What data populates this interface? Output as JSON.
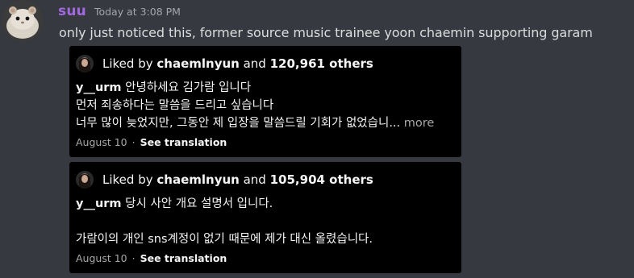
{
  "message": {
    "username": "suu",
    "timestamp": "Today at 3:08 PM",
    "text": "only just noticed this, former source music trainee yoon chaemin supporting garam",
    "avatar_icon": "hamster-avatar-icon"
  },
  "cards": [
    {
      "liked_prefix": "Liked by",
      "liked_user": "chaemlnyun",
      "liked_and": "and",
      "liked_count": "120,961 others",
      "handle": "y__urm",
      "lines": [
        "안녕하세요 김가람 입니다",
        "먼저 죄송하다는 말씀을 드리고 싶습니다",
        "너무 많이 늦었지만, 그동안 제 입장을 말씀드릴 기회가 없었습니..."
      ],
      "more": "more",
      "date": "August 10",
      "separator": "·",
      "translation": "See translation"
    },
    {
      "liked_prefix": "Liked by",
      "liked_user": "chaemlnyun",
      "liked_and": "and",
      "liked_count": "105,904 others",
      "handle": "y__urm",
      "lines": [
        "당시 사안 개요 설명서 입니다.",
        "",
        "가람이의 개인 sns계정이 없기 때문에 제가 대신 올렸습니다."
      ],
      "date": "August 10",
      "separator": "·",
      "translation": "See translation"
    }
  ],
  "colors": {
    "background": "#36393f",
    "username": "#a269e0",
    "card_background": "#000000"
  }
}
